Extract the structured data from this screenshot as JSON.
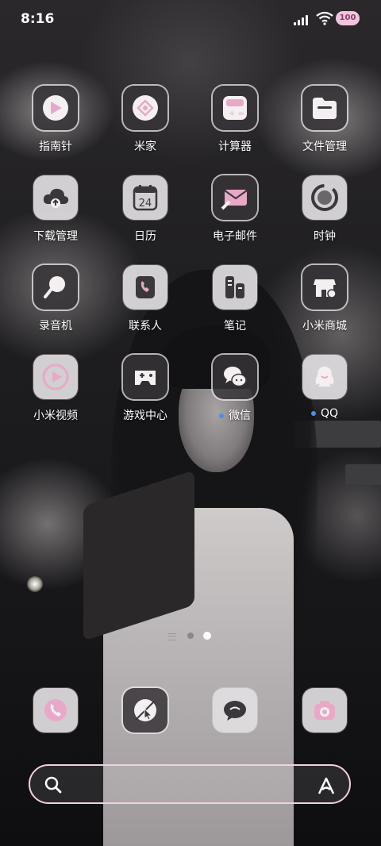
{
  "status_bar": {
    "time": "8:16",
    "battery": "100"
  },
  "apps": [
    {
      "label": "指南针",
      "icon": "compass-icon",
      "notify": false
    },
    {
      "label": "米家",
      "icon": "mijia-icon",
      "notify": false
    },
    {
      "label": "计算器",
      "icon": "calculator-icon",
      "notify": false
    },
    {
      "label": "文件管理",
      "icon": "folder-icon",
      "notify": false
    },
    {
      "label": "下载管理",
      "icon": "cloud-download-icon",
      "notify": false
    },
    {
      "label": "日历",
      "icon": "calendar-icon",
      "notify": false,
      "day": "24"
    },
    {
      "label": "电子邮件",
      "icon": "mail-icon",
      "notify": false
    },
    {
      "label": "时钟",
      "icon": "clock-icon",
      "notify": false
    },
    {
      "label": "录音机",
      "icon": "microphone-icon",
      "notify": false
    },
    {
      "label": "联系人",
      "icon": "contacts-icon",
      "notify": false
    },
    {
      "label": "笔记",
      "icon": "notes-icon",
      "notify": false
    },
    {
      "label": "小米商城",
      "icon": "store-icon",
      "notify": false
    },
    {
      "label": "小米视频",
      "icon": "play-icon",
      "notify": false
    },
    {
      "label": "游戏中心",
      "icon": "gamepad-icon",
      "notify": false
    },
    {
      "label": "微信",
      "icon": "wechat-icon",
      "notify": true
    },
    {
      "label": "QQ",
      "icon": "qq-icon",
      "notify": true
    }
  ],
  "dock": [
    {
      "icon": "phone-icon"
    },
    {
      "icon": "browser-icon"
    },
    {
      "icon": "message-icon"
    },
    {
      "icon": "camera-icon"
    }
  ],
  "pager": {
    "pages": 2,
    "current": 2
  },
  "colors": {
    "accent_pink": "#f2cfe0",
    "notify_dot": "#4b8df5",
    "icon_pink": "#e8a9c8"
  }
}
